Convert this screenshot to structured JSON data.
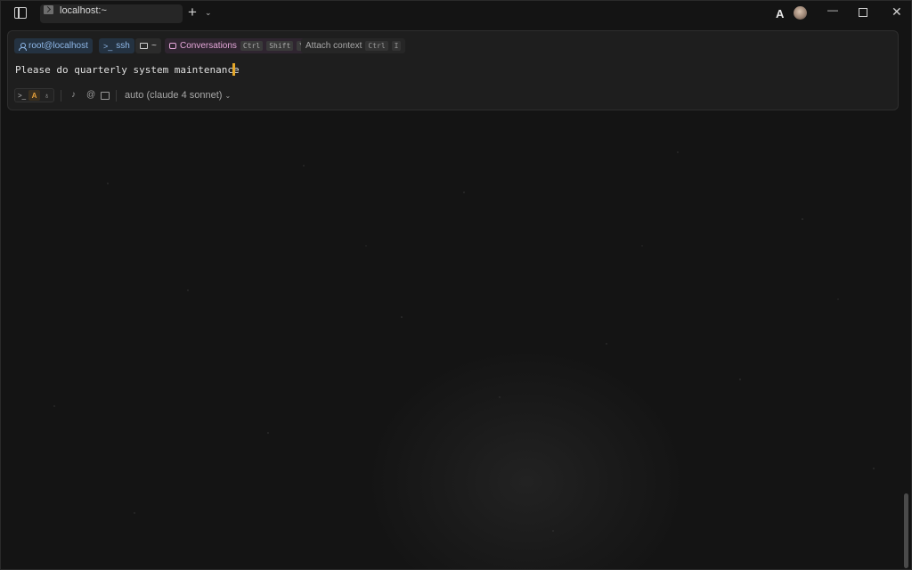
{
  "titlebar": {
    "tab_title": "localhost:~",
    "new_tab_label": "+",
    "tab_dropdown_label": "⌄",
    "minimize_label": "—",
    "close_label": "✕"
  },
  "context_chips": {
    "user": "root@localhost",
    "ssh_icon": ">_",
    "ssh": "ssh",
    "directory": "~",
    "conversations": "Conversations",
    "conversations_keys": [
      "Ctrl",
      "Shift",
      "Y"
    ],
    "attach_context": "Attach context",
    "attach_keys": [
      "Ctrl",
      "I"
    ]
  },
  "input": {
    "value": "Please do quarterly system maintenance"
  },
  "toolbar": {
    "mode_terminal_icon": ">_",
    "mode_agent_icon": "A",
    "mode_auto_icon": "♀",
    "mic_icon": "🎙",
    "at_icon": "@",
    "model": "auto (claude 4 sonnet)",
    "model_chevron": "⌄"
  },
  "colors": {
    "background": "#151515",
    "panel": "#1e1e1e",
    "accent_cursor": "#e5a728",
    "chip_blue_text": "#8fb8e8",
    "chip_pink_text": "#e4a6d8"
  }
}
